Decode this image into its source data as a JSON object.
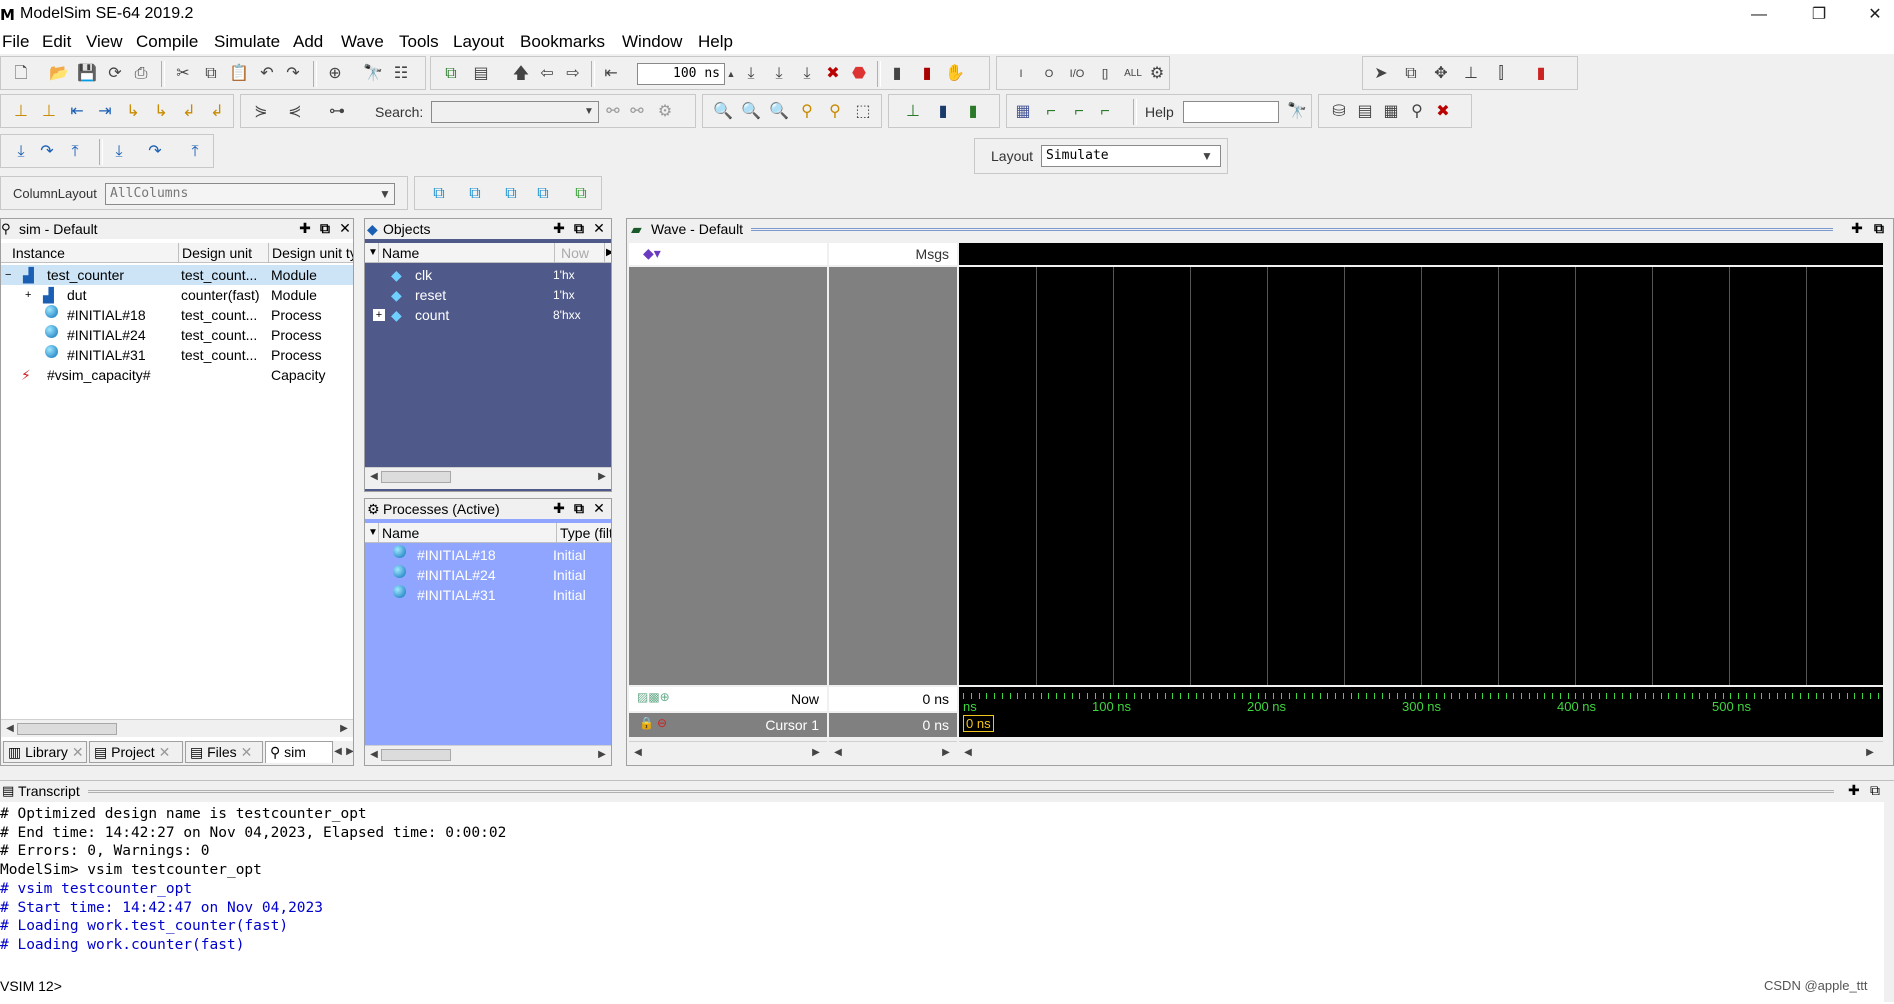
{
  "window": {
    "title": "ModelSim SE-64 2019.2",
    "controls": [
      "—",
      "❐",
      "✕"
    ]
  },
  "menu": [
    "File",
    "Edit",
    "View",
    "Compile",
    "Simulate",
    "Add",
    "Wave",
    "Tools",
    "Layout",
    "Bookmarks",
    "Window",
    "Help"
  ],
  "toolbar": {
    "run_length": "100 ns",
    "search_label": "Search:",
    "search_value": "",
    "help_label": "Help",
    "help_value": "",
    "layout_label": "Layout",
    "layout_value": "Simulate",
    "column_layout_label": "ColumnLayout",
    "column_layout_value": "AllColumns",
    "wave_buttons": [
      "I",
      "O",
      "I/O",
      "[]",
      "ALL"
    ]
  },
  "sim_panel": {
    "title": "sim - Default",
    "columns": [
      "Instance",
      "Design unit",
      "Design unit ty"
    ],
    "rows": [
      {
        "expander": "−",
        "instance": "test_counter",
        "design_unit": "test_count...",
        "type": "Module",
        "icon": "module-icon"
      },
      {
        "expander": "+",
        "instance": "dut",
        "design_unit": "counter(fast)",
        "type": "Module",
        "icon": "module-icon"
      },
      {
        "expander": "",
        "instance": "#INITIAL#18",
        "design_unit": "test_count...",
        "type": "Process",
        "icon": "process-icon"
      },
      {
        "expander": "",
        "instance": "#INITIAL#24",
        "design_unit": "test_count...",
        "type": "Process",
        "icon": "process-icon"
      },
      {
        "expander": "",
        "instance": "#INITIAL#31",
        "design_unit": "test_count...",
        "type": "Process",
        "icon": "process-icon"
      },
      {
        "expander": "",
        "instance": "#vsim_capacity#",
        "design_unit": "",
        "type": "Capacity",
        "icon": "capacity-icon"
      }
    ],
    "tabs": [
      "Library",
      "Project",
      "Files",
      "sim"
    ]
  },
  "objects_panel": {
    "title": "Objects",
    "columns": [
      "Name",
      "Now"
    ],
    "rows": [
      {
        "name": "clk",
        "value": "1'hx"
      },
      {
        "name": "reset",
        "value": "1'hx"
      },
      {
        "name": "count",
        "value": "8'hxx",
        "expander": "+"
      }
    ]
  },
  "processes_panel": {
    "title": "Processes (Active)",
    "columns": [
      "Name",
      "Type (filte"
    ],
    "rows": [
      {
        "name": "#INITIAL#18",
        "type": "Initial"
      },
      {
        "name": "#INITIAL#24",
        "type": "Initial"
      },
      {
        "name": "#INITIAL#31",
        "type": "Initial"
      }
    ]
  },
  "wave_panel": {
    "title": "Wave - Default",
    "msgs_label": "Msgs",
    "now_label": "Now",
    "now_value": "0 ns",
    "cursor_label": "Cursor 1",
    "cursor_value": "0 ns",
    "cursor_marker": "0 ns",
    "timeline_labels": [
      "ns",
      "100 ns",
      "200 ns",
      "300 ns",
      "400 ns",
      "500 ns"
    ],
    "colors": {
      "background": "#000000",
      "grid": "#555555",
      "timeline": "#3fd63f",
      "cursor": "#f2c51a"
    }
  },
  "transcript": {
    "title": "Transcript",
    "lines": [
      {
        "text": "# Optimized design name is testcounter_opt",
        "color": "#000000"
      },
      {
        "text": "# End time: 14:42:27 on Nov 04,2023, Elapsed time: 0:00:02",
        "color": "#000000"
      },
      {
        "text": "# Errors: 0, Warnings: 0",
        "color": "#000000"
      },
      {
        "text": "ModelSim> vsim testcounter_opt",
        "color": "#000000"
      },
      {
        "text": "# vsim testcounter_opt",
        "color": "#0000cc"
      },
      {
        "text": "# Start time: 14:42:47 on Nov 04,2023",
        "color": "#0000cc"
      },
      {
        "text": "# Loading work.test_counter(fast)",
        "color": "#0000cc"
      },
      {
        "text": "# Loading work.counter(fast)",
        "color": "#0000cc"
      }
    ],
    "prompt": "VSIM 12>",
    "watermark": "CSDN @apple_ttt"
  }
}
